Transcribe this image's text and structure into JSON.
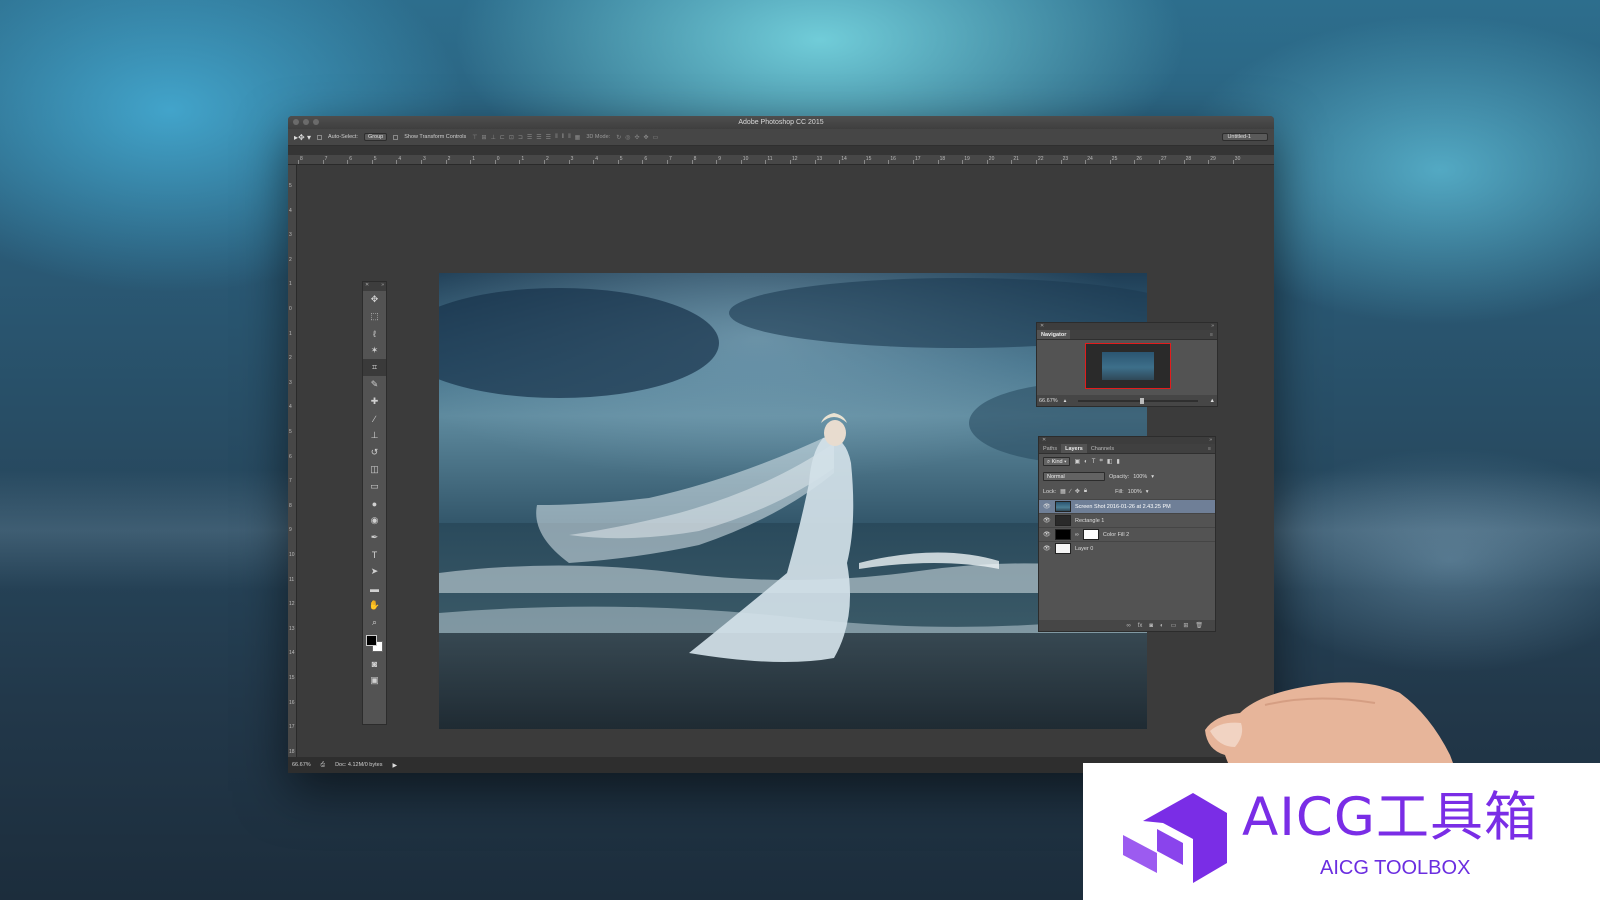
{
  "window": {
    "title": "Adobe Photoshop CC 2015"
  },
  "options_bar": {
    "tool_glyph": "▸✥ ▾",
    "auto_select_label": "Auto-Select:",
    "auto_select_value": "Group",
    "show_transform_label": "Show Transform Controls",
    "mode_3d_label": "3D Mode:",
    "workspace_value": "Untitled-1"
  },
  "ruler": {
    "top_labels": [
      "8",
      "7",
      "6",
      "5",
      "4",
      "3",
      "2",
      "1",
      "0",
      "1",
      "2",
      "3",
      "4",
      "5",
      "6",
      "7",
      "8",
      "9",
      "10",
      "11",
      "12",
      "13",
      "14",
      "15",
      "16",
      "17",
      "18",
      "19",
      "20",
      "21",
      "22",
      "23",
      "24",
      "25",
      "26",
      "27",
      "28",
      "29",
      "30"
    ],
    "left_labels": [
      "5",
      "4",
      "3",
      "2",
      "1",
      "0",
      "1",
      "2",
      "3",
      "4",
      "5",
      "6",
      "7",
      "8",
      "9",
      "10",
      "11",
      "12",
      "13",
      "14",
      "15",
      "16",
      "17",
      "18",
      "19"
    ]
  },
  "status_bar": {
    "zoom": "66.67%",
    "doc": "Doc: 4.12M/0 bytes"
  },
  "navigator": {
    "tab": "Navigator",
    "zoom": "66.67%"
  },
  "layers_panel": {
    "tabs": [
      "Paths",
      "Layers",
      "Channels"
    ],
    "active_tab": "Layers",
    "filter_kind": "Kind",
    "blend_mode": "Normal",
    "opacity_label": "Opacity:",
    "opacity_value": "100%",
    "lock_label": "Lock:",
    "fill_label": "Fill:",
    "fill_value": "100%",
    "layers": [
      {
        "name": "Screen Shot 2016-01-26 at 2.43.25 PM",
        "selected": true
      },
      {
        "name": "Rectangle 1",
        "selected": false
      },
      {
        "name": "Color Fill 2",
        "selected": false
      },
      {
        "name": "Layer 0",
        "selected": false
      }
    ]
  },
  "badge": {
    "title": "AICG工具箱",
    "subtitle": "AICG TOOLBOX",
    "accent": "#7a2de6"
  },
  "icons": [
    "move-tool-icon",
    "marquee-tool-icon",
    "lasso-tool-icon",
    "magic-wand-icon",
    "crop-tool-icon",
    "eyedropper-icon",
    "healing-brush-icon",
    "brush-icon",
    "clone-stamp-icon",
    "history-brush-icon",
    "eraser-icon",
    "gradient-icon",
    "blur-icon",
    "dodge-icon",
    "pen-icon",
    "type-icon",
    "path-select-icon",
    "rectangle-icon",
    "hand-icon",
    "zoom-icon",
    "quick-mask-icon",
    "screen-mode-icon",
    "eye-icon"
  ]
}
